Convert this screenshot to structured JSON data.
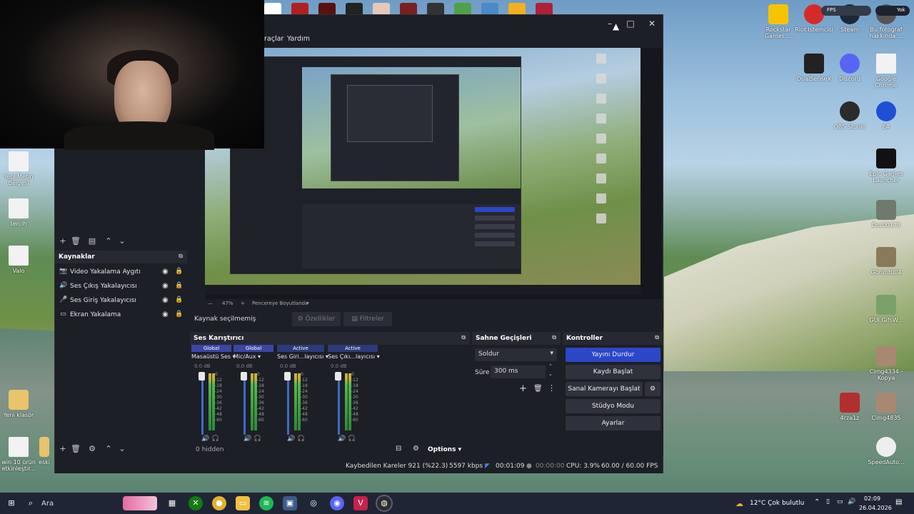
{
  "obs": {
    "menu": {
      "tools": "raçlar",
      "help": "Yardım"
    },
    "preview_status": {
      "zoom": "47%",
      "zoom_plus": "+",
      "mode": "Pencereye Boyutlandır"
    },
    "sources": {
      "title": "Kaynaklar",
      "items": [
        {
          "label": "Video Yakalama Aygıtı",
          "icon": "camera-icon"
        },
        {
          "label": "Ses Çıkış Yakalayıcısı",
          "icon": "speaker-icon"
        },
        {
          "label": "Ses Giriş Yakalayıcısı",
          "icon": "microphone-icon"
        },
        {
          "label": "Ekran Yakalama",
          "icon": "monitor-icon"
        }
      ]
    },
    "context_bar": {
      "no_source": "Kaynak seçilmemiş",
      "properties": "Özellikler",
      "filters": "Filtreler"
    },
    "mixer": {
      "title": "Ses Karıştırıcı",
      "channels": [
        {
          "badge": "Global",
          "badge_color": "#3a45a6",
          "name": "Masaüstü Ses",
          "db": "0.0 dB"
        },
        {
          "badge": "Global",
          "badge_color": "#3a45a6",
          "name": "Mic/Aux",
          "db": "0.0 dB"
        },
        {
          "badge": "Active",
          "badge_color": "#2b3a7a",
          "name": "Ses Giri...layıcısı",
          "db": "0.0 dB"
        },
        {
          "badge": "Active",
          "badge_color": "#2b3a7a",
          "name": "Ses Çıkı...layıcısı",
          "db": "0.0 dB"
        }
      ],
      "scale": [
        "0",
        "-6",
        "-12",
        "-18",
        "-24",
        "-30",
        "-36",
        "-42",
        "-48",
        "-54",
        "-60"
      ],
      "hidden": "0 hidden",
      "options": "Options"
    },
    "transitions": {
      "title": "Sahne Geçişleri",
      "selected": "Soldur",
      "duration_label": "Süre",
      "duration": "300 ms"
    },
    "controls": {
      "title": "Kontroller",
      "stop_stream": "Yayını Durdur",
      "start_record": "Kaydı Başlat",
      "virtual_cam": "Sanal Kamerayı Başlat",
      "studio_mode": "Stüdyo Modu",
      "settings": "Ayarlar",
      "accent": "#2c47c7"
    },
    "status": {
      "dropped": "Kaybedilen Kareler 921 (%22.3)",
      "bitrate": "5597 kbps",
      "stream_time": "00:01:09",
      "record_time": "00:00:00",
      "cpu": "CPU: 3.9%",
      "fps": "60.00 / 60.00 FPS"
    }
  },
  "desktop": {
    "right_icons": [
      {
        "label": "Rockstar Games ...",
        "color": "#f5c400"
      },
      {
        "label": "Riot istemcisi",
        "color": "#d22b2b"
      },
      {
        "label": "Steam",
        "color": "#1b2838"
      },
      {
        "label": "Bu fotoğraf hakkında ...",
        "color": "#555"
      },
      {
        "label": "DualSenseX",
        "color": "#222"
      },
      {
        "label": "Discord",
        "color": "#5865f2"
      },
      {
        "label": "Google Chrome",
        "color": "#eeeeee"
      },
      {
        "label": "OBS Studio",
        "color": "#2b2b2b"
      },
      {
        "label": "EA",
        "color": "#1f4fd6"
      },
      {
        "label": "Epic Games Launcher",
        "color": "#111"
      },
      {
        "label": "Dsc00173",
        "color": "#6f7a6c"
      },
      {
        "label": "Görüntü04",
        "color": "#8a7a5c"
      },
      {
        "label": "GUI GifsW...",
        "color": "#7ba06a"
      },
      {
        "label": "Cimg4334 - Kopya",
        "color": "#a98872"
      },
      {
        "label": "4rza1z",
        "color": "#b03030"
      },
      {
        "label": "Cimg4835",
        "color": "#a98872"
      },
      {
        "label": "SpeedAuto...",
        "color": "#eee"
      }
    ],
    "left_icons": [
      {
        "label": "Yeni Metin Belgesi"
      },
      {
        "label": "tercih"
      },
      {
        "label": "Valo"
      },
      {
        "label": "Yeni klasör"
      },
      {
        "label": "win 10 ürün etkinleştir..."
      },
      {
        "label": "eski"
      }
    ],
    "fps_badge": "FPS",
    "yok_badge": "Yok"
  },
  "taskbar": {
    "search": "Ara",
    "weather": "12°C  Çok bulutlu",
    "time": "02:09",
    "date": "26.04.2026"
  }
}
